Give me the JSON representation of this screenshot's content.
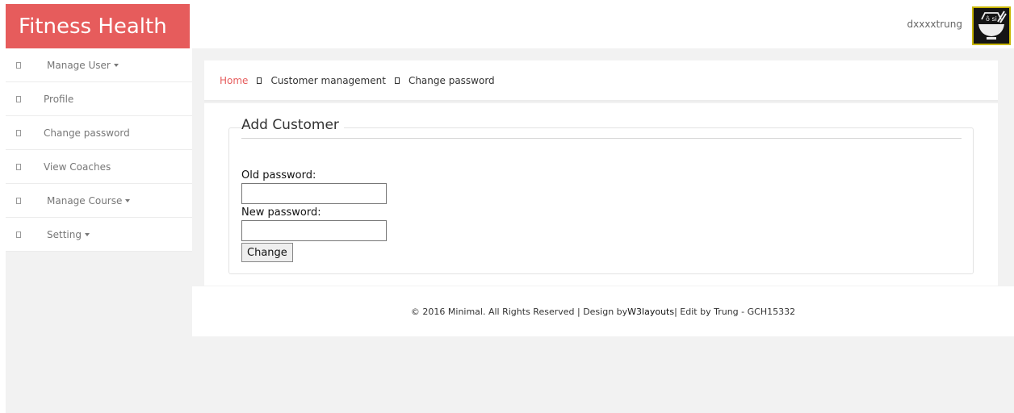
{
  "brand": {
    "title": "Fitness Health",
    "color": "#e65c5c"
  },
  "header": {
    "username": "dxxxxtrung"
  },
  "sidebar": {
    "items": [
      {
        "label": "Manage User",
        "dropdown": true
      },
      {
        "label": "Profile",
        "dropdown": false
      },
      {
        "label": "Change password",
        "dropdown": false
      },
      {
        "label": "View Coaches",
        "dropdown": false
      },
      {
        "label": "Manage Course",
        "dropdown": true
      },
      {
        "label": "Setting",
        "dropdown": true
      }
    ]
  },
  "breadcrumb": {
    "items": [
      "Home",
      "Customer management",
      "Change password"
    ]
  },
  "form": {
    "legend": "Add Customer",
    "old_password_label": "Old password:",
    "old_password_value": "",
    "new_password_label": "New password:",
    "new_password_value": "",
    "submit_label": "Change"
  },
  "footer": {
    "text_before": "© 2016 Minimal. All Rights Reserved | Design by ",
    "link": "W3layouts",
    "text_after": " | Edit by Trung - GCH15332"
  }
}
